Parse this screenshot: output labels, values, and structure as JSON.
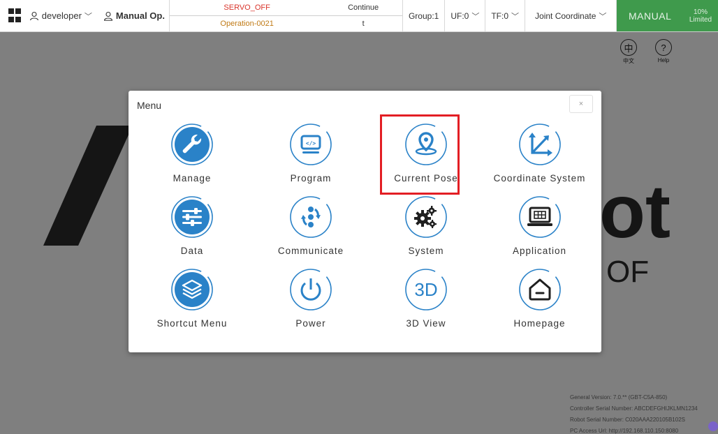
{
  "topbar": {
    "grid_icon": "grid-icon",
    "user": "developer",
    "mode": "Manual Op.",
    "servo_status": "SERVO_OFF",
    "operation": "Operation-0021",
    "run_mode_top": "Continue",
    "run_mode_bottom": "t",
    "group": "Group:1",
    "uf": "UF:0",
    "tf": "TF:0",
    "coordinate": "Joint Coordinate",
    "manual": "MANUAL",
    "speed_pct": "10%",
    "speed_state": "Limited",
    "colors": {
      "manual_bg": "#3f9a4c",
      "servo": "#d9342b",
      "operation": "#c07a15"
    }
  },
  "header_actions": {
    "lang_glyph": "中",
    "lang_label": "中文",
    "help_glyph": "?",
    "help_label": "Help"
  },
  "menu": {
    "title": "Menu",
    "close": "×",
    "accent": "#2a82c8",
    "highlight_color": "#e31e24",
    "highlighted_item": "Current Pose",
    "items": [
      {
        "label": "Manage",
        "icon": "wrench-icon"
      },
      {
        "label": "Program",
        "icon": "code-monitor-icon"
      },
      {
        "label": "Current Pose",
        "icon": "location-pin-icon"
      },
      {
        "label": "Coordinate System",
        "icon": "axes-icon"
      },
      {
        "label": "Data",
        "icon": "sliders-icon"
      },
      {
        "label": "Communicate",
        "icon": "exchange-icon"
      },
      {
        "label": "System",
        "icon": "gears-icon"
      },
      {
        "label": "Application",
        "icon": "laptop-icon"
      },
      {
        "label": "Shortcut Menu",
        "icon": "layers-icon"
      },
      {
        "label": "Power",
        "icon": "power-icon"
      },
      {
        "label": "3D View",
        "icon": "3d-icon",
        "glyph": "3D"
      },
      {
        "label": "Homepage",
        "icon": "home-icon"
      }
    ]
  },
  "background_info": {
    "general_version": "General Version:  7.0.** (GBT-C5A-850)",
    "controller_serial": "Controller Serial Number:  ABCDEFGHIJKLMN1234",
    "robot_serial": "Robot Serial Number:  C020AAA220105B102S",
    "pc_access": "PC Access Url:  http://192.168.110.150:8080"
  },
  "background_logo": {
    "fragment_right": "ot",
    "fragment_small": "OF"
  }
}
